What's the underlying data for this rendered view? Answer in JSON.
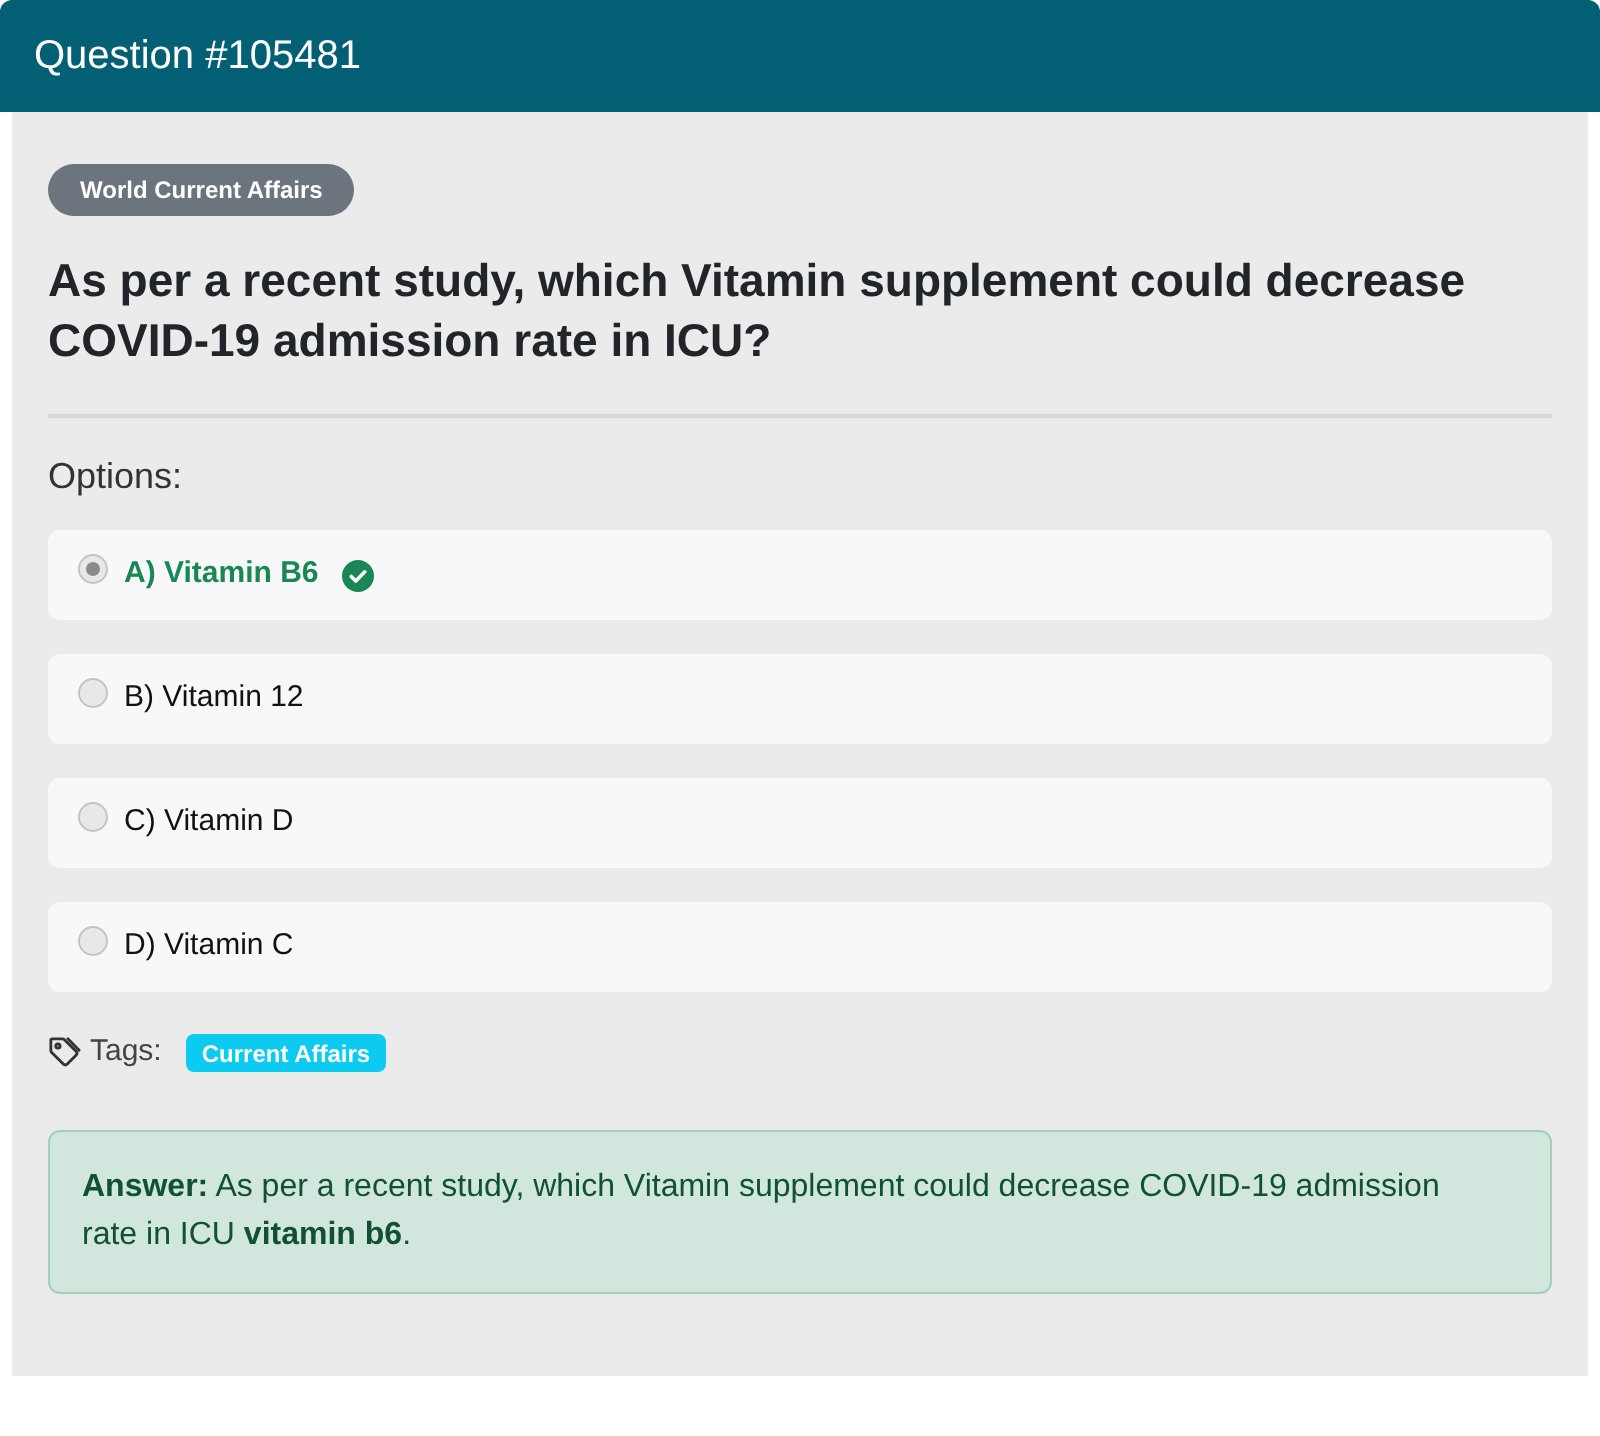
{
  "header": {
    "title": "Question #105481"
  },
  "category": {
    "label": "World Current Affairs"
  },
  "question": {
    "text": "As per a recent study, which Vitamin supplement could decrease COVID-19 admission rate in ICU?"
  },
  "options_heading": "Options:",
  "options": [
    {
      "label": "A) Vitamin B6",
      "selected": true,
      "correct": true
    },
    {
      "label": "B) Vitamin 12",
      "selected": false,
      "correct": false
    },
    {
      "label": "C) Vitamin D",
      "selected": false,
      "correct": false
    },
    {
      "label": "D) Vitamin C",
      "selected": false,
      "correct": false
    }
  ],
  "tags": {
    "label": "Tags:",
    "items": [
      {
        "label": "Current Affairs"
      }
    ]
  },
  "answer": {
    "text": "**Answer:** As per a recent study, which Vitamin supplement could decrease COVID-19 admission rate in ICU **vitamin b6**."
  }
}
